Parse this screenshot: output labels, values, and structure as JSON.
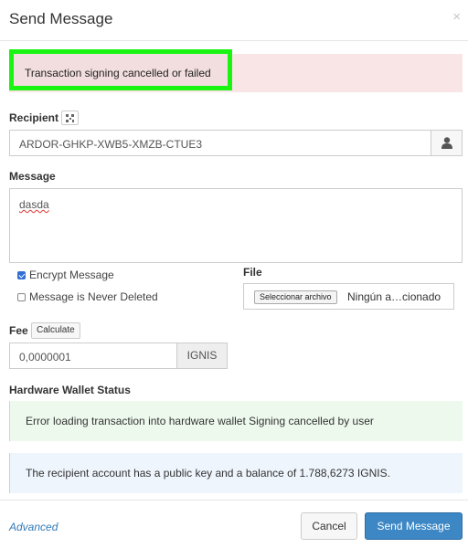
{
  "modal": {
    "title": "Send Message",
    "close_glyph": "×"
  },
  "error": {
    "text": "Transaction signing cancelled or failed"
  },
  "recipient": {
    "label": "Recipient",
    "value": "ARDOR-GHKP-XWB5-XMZB-CTUE3",
    "qr_icon": "qr-code-icon",
    "contact_icon": "user-icon"
  },
  "message": {
    "label": "Message",
    "value": "dasda"
  },
  "options": {
    "encrypt": {
      "label": "Encrypt Message",
      "checked": true
    },
    "never_deleted": {
      "label": "Message is Never Deleted",
      "checked": false
    }
  },
  "file": {
    "label": "File",
    "button_label": "Seleccionar archivo",
    "file_name": "Ningún a…cionado"
  },
  "fee": {
    "label": "Fee",
    "calculate_label": "Calculate",
    "value": "0,0000001",
    "currency": "IGNIS"
  },
  "hardware_wallet": {
    "label": "Hardware Wallet Status",
    "status_text": "Error loading transaction into hardware wallet Signing cancelled by user"
  },
  "info": {
    "text": "The recipient account has a public key and a balance of 1.788,6273 IGNIS."
  },
  "footer": {
    "advanced_label": "Advanced",
    "cancel_label": "Cancel",
    "send_label": "Send Message"
  },
  "colors": {
    "highlight": "#19f511",
    "primary": "#3c87c4",
    "link": "#337ab7"
  }
}
